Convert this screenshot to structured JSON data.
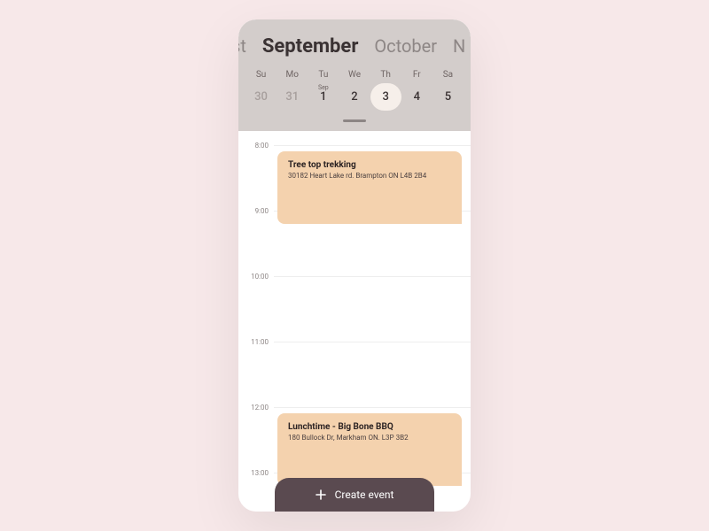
{
  "months": {
    "prev": "st",
    "current": "September",
    "next": "October",
    "after": "N"
  },
  "week": [
    "Su",
    "Mo",
    "Tu",
    "We",
    "Th",
    "Fr",
    "Sa"
  ],
  "days": [
    {
      "num": "30",
      "other": true
    },
    {
      "num": "31",
      "other": true
    },
    {
      "num": "1",
      "pre": "Sep"
    },
    {
      "num": "2"
    },
    {
      "num": "3",
      "selected": true
    },
    {
      "num": "4"
    },
    {
      "num": "5"
    }
  ],
  "times": [
    "8:00",
    "9:00",
    "10:00",
    "11:00",
    "12:00",
    "13:00"
  ],
  "hourHeight": 74,
  "events": [
    {
      "title": "Tree top trekking",
      "location": "30182 Heart Lake rd. Brampton ON L4B 2B4",
      "start": 8.1,
      "end": 9.2
    },
    {
      "title": "Lunchtime - Big Bone BBQ",
      "location": "180 Bullock Dr, Markham ON. L3P 3B2",
      "start": 12.1,
      "end": 13.2
    }
  ],
  "createLabel": "Create event"
}
